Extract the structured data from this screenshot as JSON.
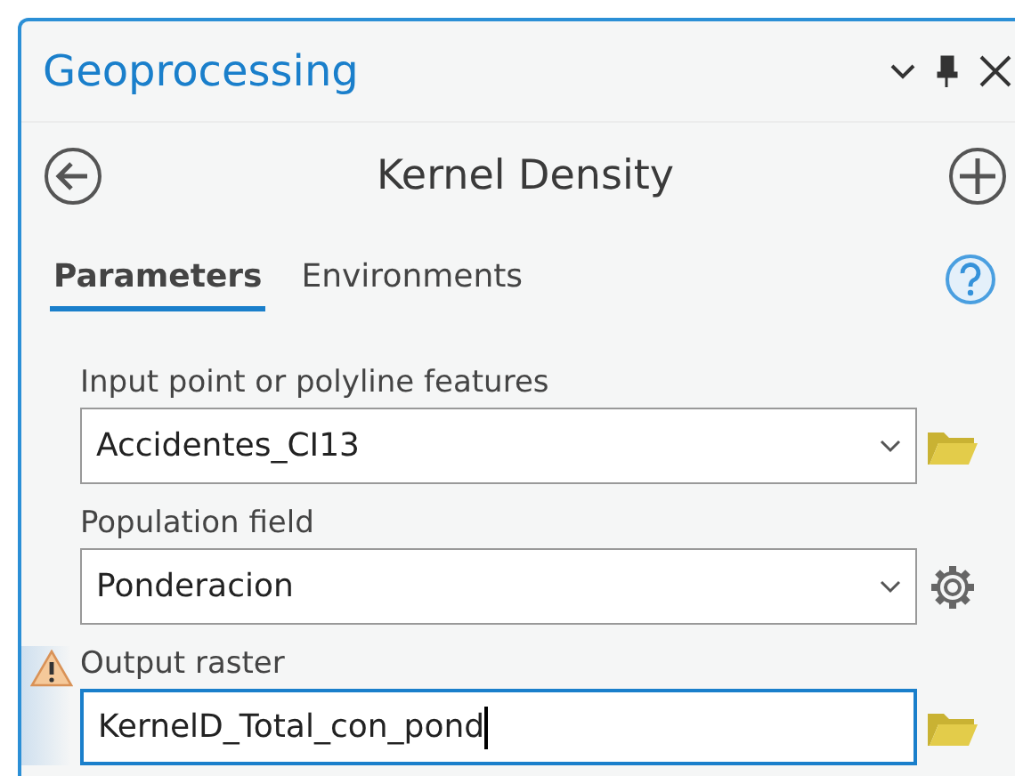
{
  "panel": {
    "title": "Geoprocessing"
  },
  "tool": {
    "title": "Kernel Density"
  },
  "tabs": [
    {
      "label": "Parameters",
      "selected": true
    },
    {
      "label": "Environments",
      "selected": false
    }
  ],
  "parameters": [
    {
      "label": "Input point or polyline features",
      "value": "Accidentes_CI13",
      "kind": "dropdown",
      "button": {
        "kind": "browse"
      },
      "warning": false,
      "focused": false
    },
    {
      "label": "Population field",
      "value": "Ponderacion",
      "kind": "dropdown",
      "button": {
        "kind": "settings"
      },
      "warning": false,
      "focused": false
    },
    {
      "label": "Output raster",
      "value": "KernelD_Total_con_pond",
      "kind": "text",
      "button": {
        "kind": "browse"
      },
      "warning": true,
      "focused": true
    }
  ]
}
